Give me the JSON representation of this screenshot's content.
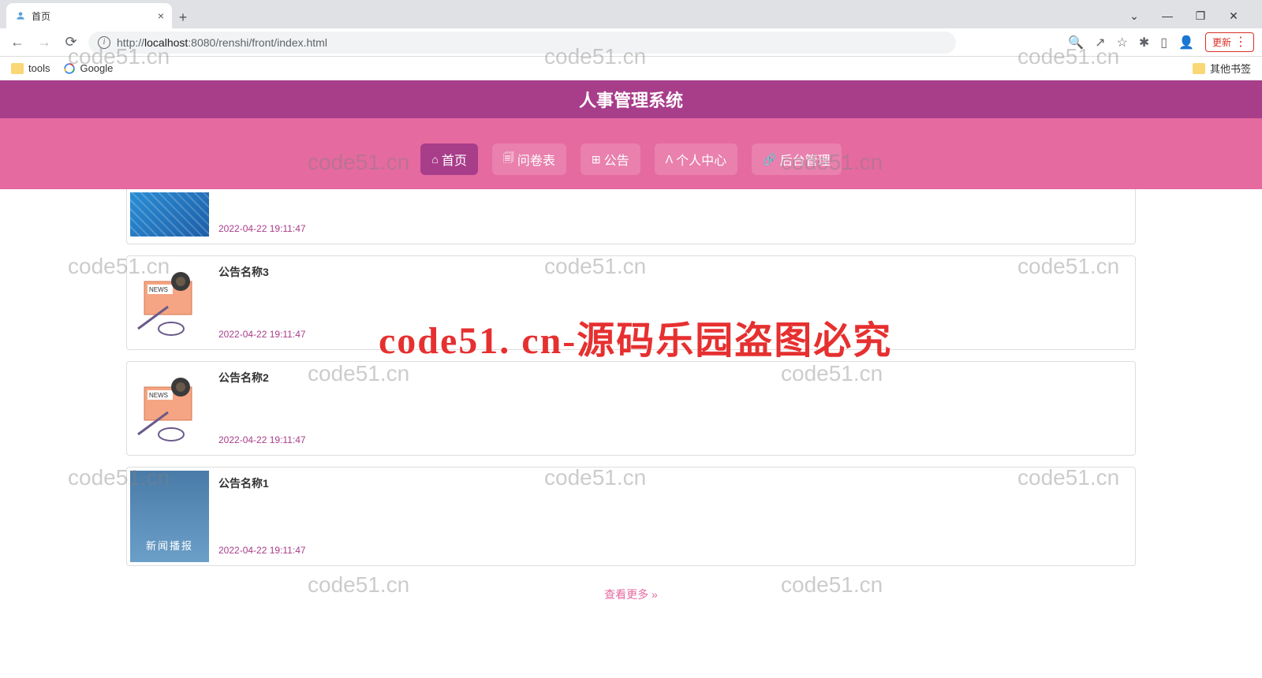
{
  "browser": {
    "tab_title": "首页",
    "url_prefix": "http://",
    "url_host": "localhost",
    "url_port_path": ":8080/renshi/front/index.html",
    "update_label": "更新"
  },
  "bookmarks": {
    "tools": "tools",
    "google": "Google",
    "other": "其他书签"
  },
  "header": {
    "title": "人事管理系统"
  },
  "nav": {
    "items": [
      {
        "icon": "⌂",
        "label": "首页",
        "active": true
      },
      {
        "icon": "🗐",
        "label": "问卷表",
        "active": false
      },
      {
        "icon": "⊞",
        "label": "公告",
        "active": false
      },
      {
        "icon": "ᐱ",
        "label": "人中心",
        "icon2": "个",
        "active": false
      },
      {
        "icon": "🔗",
        "label": "后台管理",
        "active": false
      }
    ]
  },
  "announcements": [
    {
      "title": "",
      "time": "2022-04-22 19:11:47",
      "img": "tech"
    },
    {
      "title": "公告名称3",
      "time": "2022-04-22 19:11:47",
      "img": "news"
    },
    {
      "title": "公告名称2",
      "time": "2022-04-22 19:11:47",
      "img": "news"
    },
    {
      "title": "公告名称1",
      "time": "2022-04-22 19:11:47",
      "img": "sky",
      "sky_text": "新闻播报"
    }
  ],
  "view_more": "查看更多 »",
  "watermark": "code51.cn",
  "watermark_red": "code51. cn-源码乐园盗图必究"
}
